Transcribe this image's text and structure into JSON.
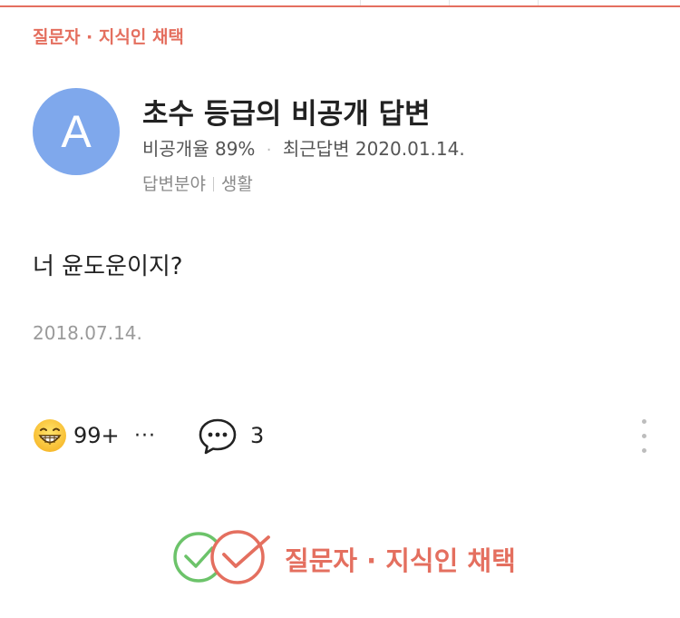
{
  "header": {
    "badge": "질문자 · 지식인 채택"
  },
  "profile": {
    "avatar_letter": "A",
    "name": "초수 등급의 비공개 답변",
    "private_rate_label": "비공개율",
    "private_rate": "89%",
    "recent_answer_label": "최근답변",
    "recent_answer_date": "2020.01.14.",
    "field_label": "답변분야",
    "field_value": "생활"
  },
  "answer": {
    "text": "너 윤도운이지?",
    "date": "2018.07.14."
  },
  "actions": {
    "reaction_icon": "grinning-face-icon",
    "reaction_count": "99+",
    "more_label": "···",
    "comment_icon": "speech-bubble-icon",
    "comment_count": "3",
    "menu_icon": "vertical-dots-icon"
  },
  "selection": {
    "label": "질문자 · 지식인 채택",
    "icon": "double-check-circles-icon"
  },
  "colors": {
    "accent": "#e46f5f",
    "avatar": "#7fa8ec",
    "check_green": "#6cc36a"
  }
}
